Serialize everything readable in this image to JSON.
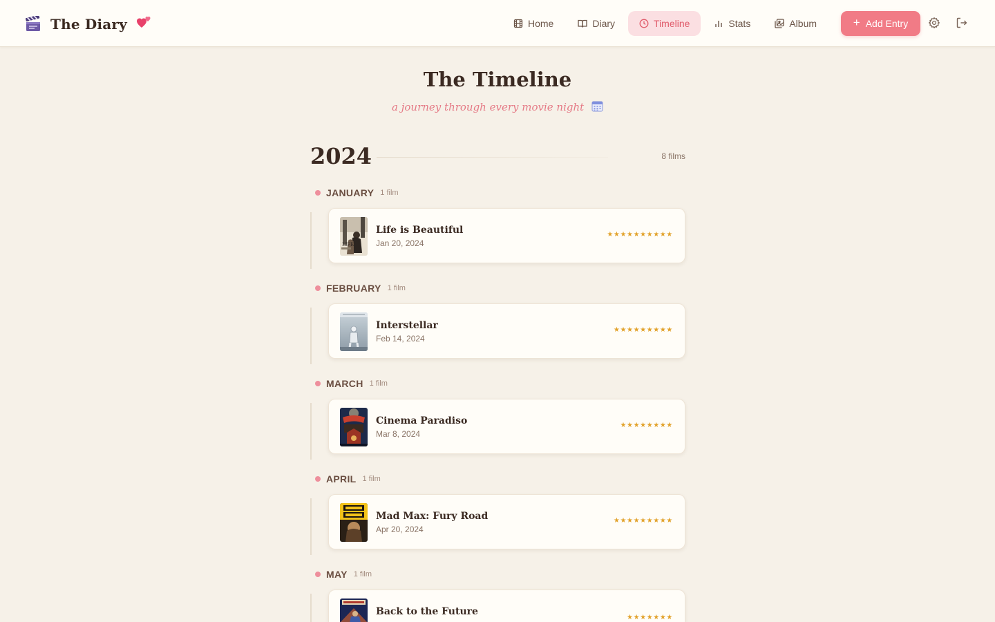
{
  "brand": {
    "name": "The Diary"
  },
  "nav": {
    "items": [
      {
        "label": "Home",
        "icon": "film-icon",
        "active": false
      },
      {
        "label": "Diary",
        "icon": "book-icon",
        "active": false
      },
      {
        "label": "Timeline",
        "icon": "clock-icon",
        "active": true
      },
      {
        "label": "Stats",
        "icon": "bar-chart-icon",
        "active": false
      },
      {
        "label": "Album",
        "icon": "photo-album-icon",
        "active": false
      }
    ],
    "add_label": "Add Entry"
  },
  "colors": {
    "accent": "#f17b86",
    "active_bg": "#fbdfe2",
    "star": "#e2a22b",
    "background": "#f6f1e8"
  },
  "page": {
    "title": "The Timeline",
    "subtitle": "a journey through every movie night"
  },
  "timeline": {
    "year": "2024",
    "year_count": "8 films",
    "months": [
      {
        "name": "JANUARY",
        "count": "1 film",
        "film": {
          "title": "Life is Beautiful",
          "date": "Jan 20, 2024",
          "rating": 10,
          "stars": "★★★★★★★★★★"
        }
      },
      {
        "name": "FEBRUARY",
        "count": "1 film",
        "film": {
          "title": "Interstellar",
          "date": "Feb 14, 2024",
          "rating": 9,
          "stars": "★★★★★★★★★"
        }
      },
      {
        "name": "MARCH",
        "count": "1 film",
        "film": {
          "title": "Cinema Paradiso",
          "date": "Mar 8, 2024",
          "rating": 8,
          "stars": "★★★★★★★★"
        }
      },
      {
        "name": "APRIL",
        "count": "1 film",
        "film": {
          "title": "Mad Max: Fury Road",
          "date": "Apr 20, 2024",
          "rating": 9,
          "stars": "★★★★★★★★★"
        }
      },
      {
        "name": "MAY",
        "count": "1 film",
        "film": {
          "title": "Back to the Future",
          "date": "",
          "rating": 7,
          "stars": "★★★★★★★"
        }
      }
    ]
  }
}
